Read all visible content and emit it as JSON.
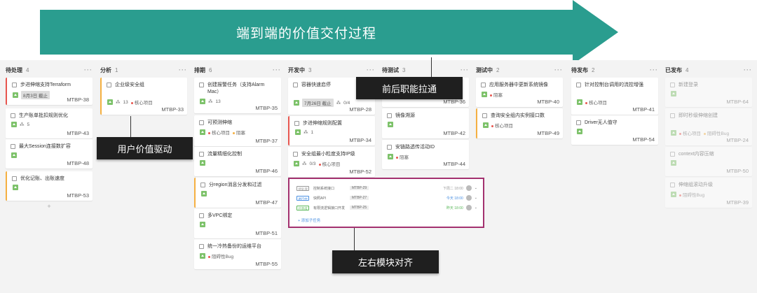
{
  "banner": {
    "title": "端到端的价值交付过程",
    "color": "#2a9d8f"
  },
  "callouts": {
    "user_value": "用户价值驱动",
    "roles": "前后职能拉通",
    "align": "左右模块对齐"
  },
  "columns": [
    {
      "name": "待处理",
      "count": "4",
      "more": "···",
      "cards": [
        {
          "title": "步进伸缩支持Terraform",
          "date": "8月3日 截止",
          "code": "MTBP-38",
          "border": "red"
        },
        {
          "title": "生产账单批扣规则优化",
          "sub": "5",
          "code": "MTBP-43",
          "border": ""
        },
        {
          "title": "最大Session连接数扩容",
          "code": "MTBP-48",
          "border": ""
        },
        {
          "title": "优化记账、出账速度",
          "code": "MTBP-53",
          "border": "orange"
        }
      ],
      "add": "+"
    },
    {
      "name": "分析",
      "count": "1",
      "more": "···",
      "cards": [
        {
          "title": "企业级安全组",
          "sub": "13",
          "tag": "核心项目",
          "code": "MTBP-33",
          "border": "orange"
        }
      ]
    },
    {
      "name": "排期",
      "count": "6",
      "more": "···",
      "cards": [
        {
          "title": "创建报警任务（支持Alarm Mac）",
          "sub": "13",
          "code": "MTBP-35",
          "border": ""
        },
        {
          "title": "可预测伸缩",
          "tag": "核心项目",
          "tag2": "阻塞",
          "code": "MTBP-37",
          "border": ""
        },
        {
          "title": "流量精细化控制",
          "code": "MTBP-46",
          "border": ""
        },
        {
          "title": "分region消息分发和过滤",
          "code": "MTBP-47",
          "border": "orange"
        },
        {
          "title": "多VPC绑定",
          "code": "MTBP-51",
          "border": ""
        },
        {
          "title": "统一冷热备份的运维平台",
          "tag": "阻碍性Bug",
          "code": "MTBP-55",
          "border": ""
        }
      ]
    },
    {
      "name": "开发中",
      "count": "3",
      "more": "···",
      "cards": [
        {
          "title": "容器快速启停",
          "date": "7月26日 截止",
          "sub": "0/4",
          "code": "MTBP-28",
          "border": ""
        },
        {
          "title": "步进伸缩规则配置",
          "sub": "1",
          "code": "MTBP-34",
          "border": "red"
        },
        {
          "title": "安全组最小粒度支持IP级",
          "tag": "核心项目",
          "sub": "0/3",
          "code": "MTBP-52",
          "border": ""
        }
      ]
    },
    {
      "name": "待测试",
      "count": "3",
      "more": "···",
      "cards": [
        {
          "title": "",
          "code": "MTBP-36",
          "border": ""
        },
        {
          "title": "镜像溯源",
          "code": "MTBP-42",
          "border": ""
        },
        {
          "title": "安链路透传活动ID",
          "tag": "阻塞",
          "code": "MTBP-44",
          "border": ""
        }
      ]
    },
    {
      "name": "测试中",
      "count": "2",
      "more": "···",
      "cards": [
        {
          "title": "应用服务器中更新系统镜像",
          "tag": "阻塞",
          "code": "MTBP-40",
          "border": ""
        },
        {
          "title": "查询安全组内实例接口数",
          "tag": "核心项目",
          "code": "MTBP-49",
          "border": "orange"
        }
      ]
    },
    {
      "name": "待发布",
      "count": "2",
      "more": "···",
      "cards": [
        {
          "title": "针对控制台调用的流控增强",
          "tag": "核心项目",
          "code": "MTBP-41",
          "border": ""
        },
        {
          "title": "Driver无人值守",
          "code": "MTBP-54",
          "border": ""
        }
      ]
    },
    {
      "name": "已发布",
      "count": "4",
      "more": "···",
      "cards": [
        {
          "title": "新建登录",
          "code": "MTBP-64",
          "border": ""
        },
        {
          "title": "即时秒级伸缩创建",
          "tag": "核心项目",
          "tag2": "阻碍性Bug",
          "code": "MTBP-24",
          "border": ""
        },
        {
          "title": "context内容压缩",
          "code": "MTBP-50",
          "border": ""
        },
        {
          "title": "伸缩组滚动升级",
          "tag": "阻碍性Bug",
          "code": "MTBP-39",
          "border": ""
        }
      ]
    }
  ],
  "subtasks": [
    {
      "status": "待处理",
      "title": "控制系统接口",
      "code": "MTBP-29",
      "time": "下周二 18:00",
      "status_color": "#999999"
    },
    {
      "status": "进行中",
      "title": "快照API",
      "code": "MTBP-27",
      "time": "今天 18:00",
      "status_color": "#4a90e2"
    },
    {
      "status": "已完成",
      "title": "有限流逻辑接口开发",
      "code": "MTBP-25",
      "time": "昨天 18:00",
      "status_color": "#5cb85c"
    }
  ],
  "add_subtask": "+ 添加子任务"
}
